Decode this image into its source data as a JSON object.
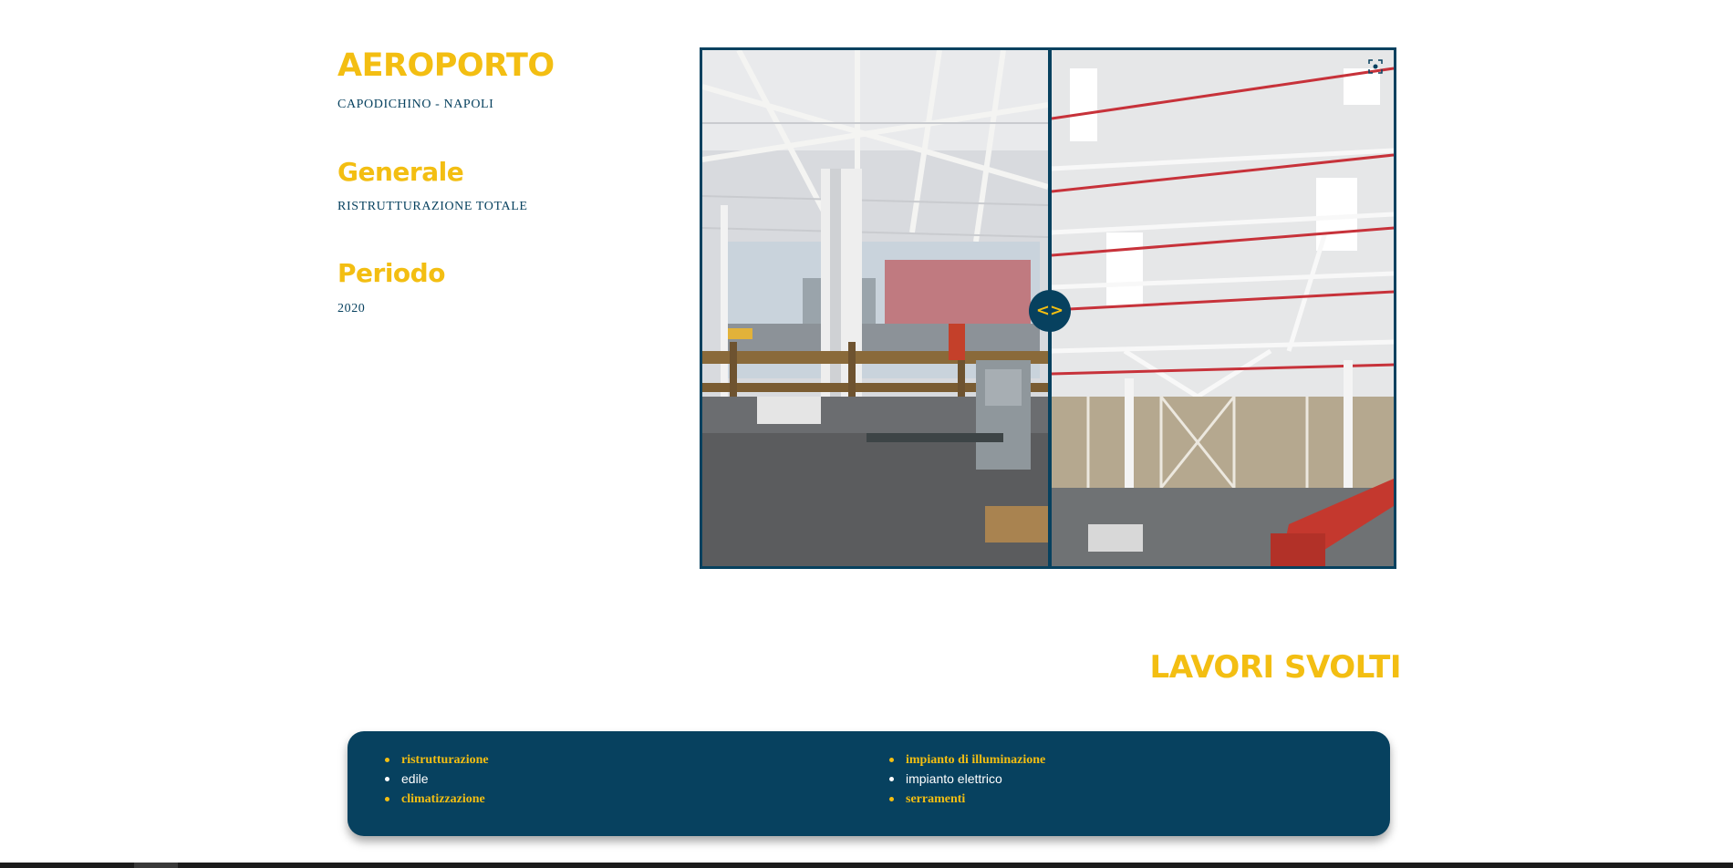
{
  "project": {
    "title": "AEROPORTO",
    "location": "CAPODICHINO - NAPOLI"
  },
  "general": {
    "heading": "Generale",
    "value": "RISTRUTTURAZIONE TOTALE"
  },
  "period": {
    "heading": "Periodo",
    "value": "2020"
  },
  "comparison": {
    "handle_label": "<>",
    "expand_icon": "expand-icon",
    "position": 0.5
  },
  "works": {
    "heading": "LAVORI SVOLTI",
    "column_1": [
      "ristrutturazione",
      "edile",
      "climatizzazione"
    ],
    "column_2": [
      "impianto di illuminazione",
      "impianto elettrico",
      "serramenti"
    ]
  },
  "colors": {
    "accent": "#f3be12",
    "primary": "#07415f",
    "background": "#ffffff"
  }
}
